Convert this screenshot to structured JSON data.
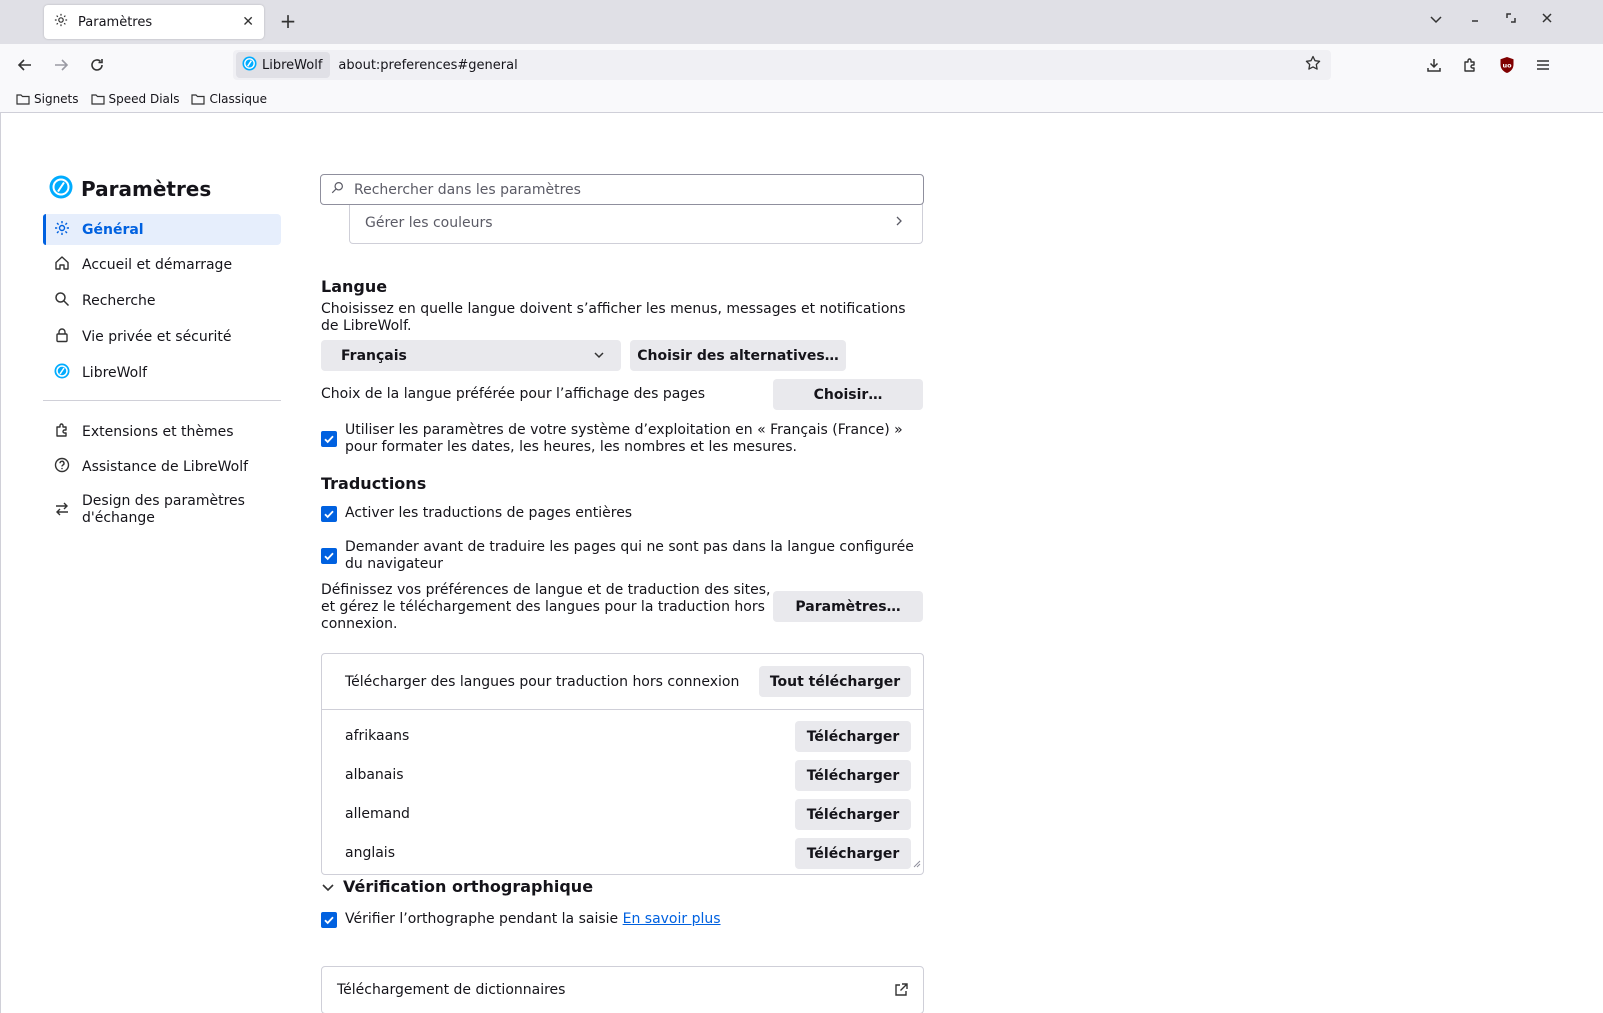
{
  "tabbar": {
    "tab_title": "Paramètres",
    "new_tab": "+"
  },
  "navbar": {
    "identity_label": "LibreWolf",
    "url": "about:preferences#general"
  },
  "bookmarks": [
    {
      "label": "Signets"
    },
    {
      "label": "Speed Dials"
    },
    {
      "label": "Classique"
    }
  ],
  "sidebar": {
    "title": "Paramètres",
    "items": [
      {
        "label": "Général"
      },
      {
        "label": "Accueil et démarrage"
      },
      {
        "label": "Recherche"
      },
      {
        "label": "Vie privée et sécurité"
      },
      {
        "label": "LibreWolf"
      }
    ],
    "footer_items": [
      {
        "label": "Extensions et thèmes"
      },
      {
        "label": "Assistance de LibreWolf"
      },
      {
        "label": "Design des paramètres d'échange"
      }
    ]
  },
  "search": {
    "placeholder": "Rechercher dans les paramètres"
  },
  "colors": {
    "label": "Gérer les couleurs"
  },
  "language": {
    "heading": "Langue",
    "description": "Choisissez en quelle langue doivent s’afficher les menus, messages et notifications de LibreWolf.",
    "selected": "Français",
    "alternatives_button": "Choisir des alternatives…",
    "page_lang_label": "Choix de la langue préférée pour l’affichage des pages",
    "choose_button": "Choisir…",
    "os_locale_checkbox": "Utiliser les paramètres de votre système d’exploitation en « Français (France) » pour formater les dates, les heures, les nombres et les mesures."
  },
  "translations": {
    "heading": "Traductions",
    "enable_checkbox": "Activer les traductions de pages entières",
    "ask_checkbox": "Demander avant de traduire les pages qui ne sont pas dans la langue configurée du navigateur",
    "settings_description": "Définissez vos préférences de langue et de traduction des sites, et gérez le téléchargement des langues pour la traduction hors connexion.",
    "settings_button": "Paramètres…",
    "offline_header": "Télécharger des langues pour traduction hors connexion",
    "download_all_button": "Tout télécharger",
    "languages": [
      {
        "name": "afrikaans",
        "button": "Télécharger"
      },
      {
        "name": "albanais",
        "button": "Télécharger"
      },
      {
        "name": "allemand",
        "button": "Télécharger"
      },
      {
        "name": "anglais",
        "button": "Télécharger"
      }
    ]
  },
  "spellcheck": {
    "heading": "Vérification orthographique",
    "checkbox_label": "Vérifier l’orthographe pendant la saisie",
    "learn_more": "En savoir plus",
    "dictionaries": "Téléchargement de dictionnaires"
  },
  "colors_theme": {
    "accent": "#0061e0",
    "checkbox": "#0061e0",
    "button_bg": "#e9e9ed",
    "active_nav_bg": "#e6eefc"
  }
}
